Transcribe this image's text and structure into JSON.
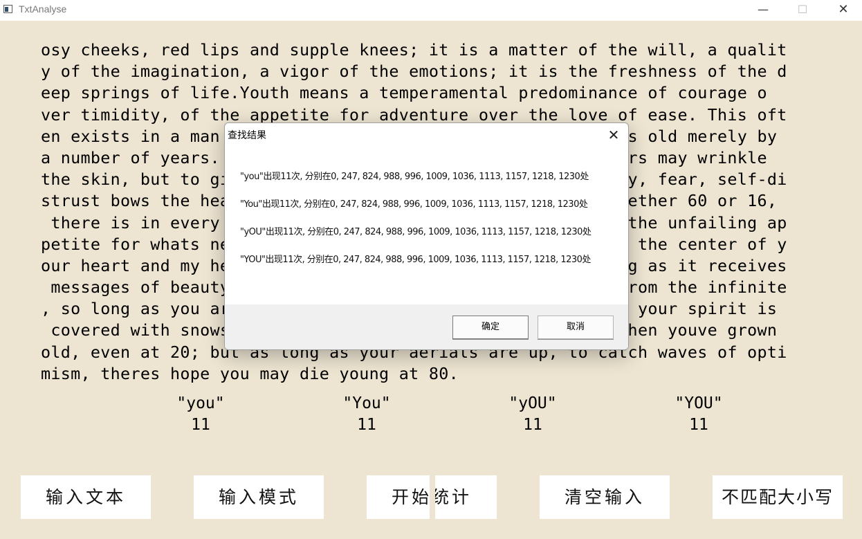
{
  "window": {
    "title": "TxtAnalyse"
  },
  "passage_lines": [
    "osy cheeks, red lips and supple knees; it is a matter of the will, a qualit",
    "y of the imagination, a vigor of the emotions; it is the freshness of the d",
    "eep springs of life.Youth means a temperamental predominance of courage o",
    "ver timidity, of the appetite for adventure over the love of ease. This oft",
    "en exists in a man of 60 more than a boy of 20. Nobody grows old merely by",
    "a number of years. We grow old by deserting our ideals. Years may wrinkle",
    "the skin, but to give up enthusiasm wrinkles the soul. Worry, fear, self-di",
    "strust bows the heart and turns the spirit back to dust. Whether 60 or 16,",
    " there is in every human beings heart the lure of wonders, the unfailing ap",
    "petite for whats next and the joy of the game of living. In the center of y",
    "our heart and my heart, there is a wireless station; so long as it receives",
    " messages of beauty, hope, courage and power from man and from the infinite",
    ", so long as you are young. When your aerials are down, and your spirit is",
    " covered with snows of cynicism and the ice of pessimism, then youve grown",
    "old, even at 20; but as long as your aerials are up, to catch waves of opti",
    "mism, theres hope you may die young at 80."
  ],
  "counts": [
    {
      "term": "\"you\"",
      "value": "11"
    },
    {
      "term": "\"You\"",
      "value": "11"
    },
    {
      "term": "\"yOU\"",
      "value": "11"
    },
    {
      "term": "\"YOU\"",
      "value": "11"
    }
  ],
  "buttons": {
    "input_text": "输入文本",
    "input_pattern": "输入模式",
    "start_count": "开始统计",
    "clear_input": "清空输入",
    "ignore_case": "不匹配大小写"
  },
  "dialog": {
    "title": "查找结果",
    "lines": [
      "\"you\"出现11次, 分别在0, 247, 824, 988, 996, 1009, 1036, 1113, 1157, 1218, 1230处",
      "\"You\"出现11次, 分别在0, 247, 824, 988, 996, 1009, 1036, 1113, 1157, 1218, 1230处",
      "\"yOU\"出现11次, 分别在0, 247, 824, 988, 996, 1009, 1036, 1113, 1157, 1218, 1230处",
      "\"YOU\"出现11次, 分别在0, 247, 824, 988, 996, 1009, 1036, 1113, 1157, 1218, 1230处"
    ],
    "ok_label": "确定",
    "cancel_label": "取消"
  },
  "icons": {
    "window_minimize": "minimize-icon",
    "window_maximize": "maximize-icon",
    "window_close": "close-icon",
    "dialog_close": "close-icon"
  }
}
